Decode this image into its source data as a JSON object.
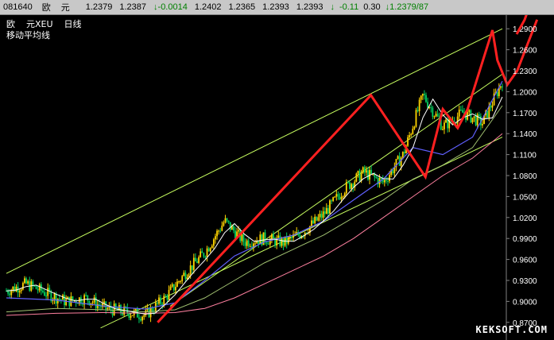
{
  "quote_bar": {
    "code": "081640",
    "name_part1": "欧",
    "name_part2": "元",
    "open": "1.2379",
    "high": "1.2387",
    "change_arrow": "↓",
    "change": "-0.0014",
    "prev_close": "1.2402",
    "low": "1.2365",
    "last1": "1.2393",
    "last2": "1.2393",
    "change_pct_arrow": "↓",
    "change_pct": "-0.11",
    "volume": "0.30",
    "bid_ask_arrow": "↓",
    "bid_ask": "1.2379/87"
  },
  "legend": {
    "line1_part1": "欧",
    "line1_part2": "元XEU",
    "line1_part3": "日线",
    "line2": "移动平均线"
  },
  "watermark": "KEKSOFT.COM",
  "colors": {
    "background": "#000000",
    "candle_up": "#ffd400",
    "candle_down": "#00d060",
    "trend_line": "#ff2020",
    "channel": "#c8ff60",
    "ma_short": "#ffffff",
    "ma_mid": "#6060ff",
    "ma_long": "#a0c070",
    "ma_longest": "#ff80a0"
  },
  "chart_data": {
    "type": "line",
    "y_ticks": [
      "1.2900",
      "1.2600",
      "1.2300",
      "1.2000",
      "1.1700",
      "1.1400",
      "1.1100",
      "1.0800",
      "1.0500",
      "1.0200",
      "0.9900",
      "0.9600",
      "0.9300",
      "0.9000",
      "0.8700"
    ],
    "ylim": [
      0.855,
      1.305
    ],
    "price_path": {
      "x": [
        0,
        4,
        8,
        12,
        16,
        20,
        24,
        28,
        32,
        36,
        40,
        44,
        48,
        52,
        56,
        60,
        64,
        68,
        72,
        76,
        80,
        84,
        88,
        92,
        96,
        100
      ],
      "y": [
        0.915,
        0.925,
        0.912,
        0.9,
        0.905,
        0.89,
        0.885,
        0.88,
        0.905,
        0.94,
        0.97,
        1.015,
        0.985,
        0.99,
        0.984,
        1.0,
        1.025,
        1.06,
        1.085,
        1.07,
        1.11,
        1.195,
        1.15,
        1.17,
        1.155,
        1.215
      ]
    },
    "trend_line": {
      "x": [
        30.5,
        73.5,
        84.5,
        88,
        91,
        93,
        98,
        99,
        101,
        103,
        107
      ],
      "y": [
        0.87,
        1.195,
        1.078,
        1.175,
        1.148,
        1.175,
        1.288,
        1.245,
        1.21,
        1.23,
        1.303
      ]
    },
    "channel_upper": {
      "x": [
        0,
        100
      ],
      "y": [
        0.94,
        1.29
      ]
    },
    "channel_lower": {
      "x": [
        19,
        100
      ],
      "y": [
        0.862,
        1.135
      ]
    },
    "channel_mid": {
      "x": [
        33,
        100
      ],
      "y": [
        0.893,
        1.225
      ]
    },
    "ma_mid": {
      "x": [
        0,
        10,
        20,
        28,
        34,
        40,
        46,
        52,
        58,
        64,
        70,
        76,
        82,
        88,
        94,
        100
      ],
      "y": [
        0.905,
        0.902,
        0.893,
        0.889,
        0.898,
        0.93,
        0.965,
        0.985,
        0.995,
        1.015,
        1.045,
        1.075,
        1.12,
        1.11,
        1.135,
        1.215
      ]
    },
    "ma_long": {
      "x": [
        0,
        10,
        20,
        28,
        34,
        40,
        46,
        52,
        58,
        64,
        70,
        76,
        82,
        88,
        94,
        100
      ],
      "y": [
        0.885,
        0.89,
        0.888,
        0.885,
        0.888,
        0.905,
        0.93,
        0.955,
        0.975,
        0.995,
        1.02,
        1.045,
        1.075,
        1.095,
        1.12,
        1.18
      ]
    },
    "ma_longest": {
      "x": [
        0,
        10,
        20,
        28,
        34,
        40,
        46,
        52,
        58,
        64,
        70,
        76,
        82,
        88,
        94,
        100
      ],
      "y": [
        0.88,
        0.883,
        0.884,
        0.883,
        0.884,
        0.89,
        0.905,
        0.925,
        0.945,
        0.965,
        0.99,
        1.02,
        1.05,
        1.08,
        1.105,
        1.14
      ]
    }
  }
}
